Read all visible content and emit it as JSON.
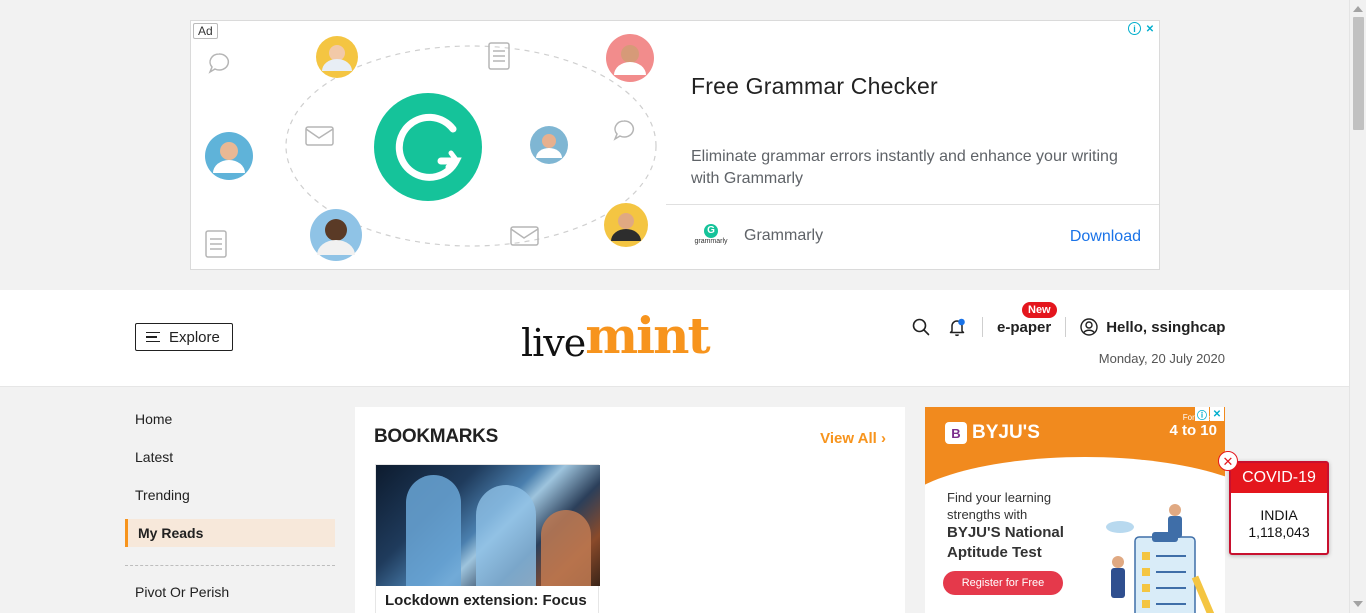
{
  "ad_banner": {
    "badge": "Ad",
    "headline": "Free Grammar Checker",
    "description": "Eliminate grammar errors instantly and enhance your writing with Grammarly",
    "advertiser": "Grammarly",
    "advertiser_logo_text": "grammarly",
    "cta": "Download"
  },
  "header": {
    "explore_label": "Explore",
    "logo_live": "live",
    "logo_mint": "mint",
    "epaper_label": "e-paper",
    "new_badge": "New",
    "greeting": "Hello, ssinghcap",
    "date": "Monday, 20 July 2020"
  },
  "leftnav": {
    "items": [
      {
        "label": "Home"
      },
      {
        "label": "Latest"
      },
      {
        "label": "Trending"
      },
      {
        "label": "My Reads"
      }
    ],
    "section_item": "Pivot Or Perish"
  },
  "bookmarks": {
    "title": "BOOKMARKS",
    "view_all": "View All",
    "cards": [
      {
        "headline": "Lockdown extension: Focus"
      }
    ]
  },
  "byju_ad": {
    "brand": "BYJU'S",
    "grade_small": "For Class",
    "grade_big": "4 to 10",
    "line1": "Find your learning",
    "line2": "strengths with",
    "bold1": "BYJU'S National",
    "bold2": "Aptitude Test",
    "cta": "Register for Free"
  },
  "covid": {
    "title": "COVID-19",
    "country": "INDIA",
    "count": "1,118,043"
  },
  "colors": {
    "accent": "#f7941d",
    "alert": "#e4161d",
    "ad_link": "#1a73e8",
    "grammarly_green": "#15c39a"
  }
}
